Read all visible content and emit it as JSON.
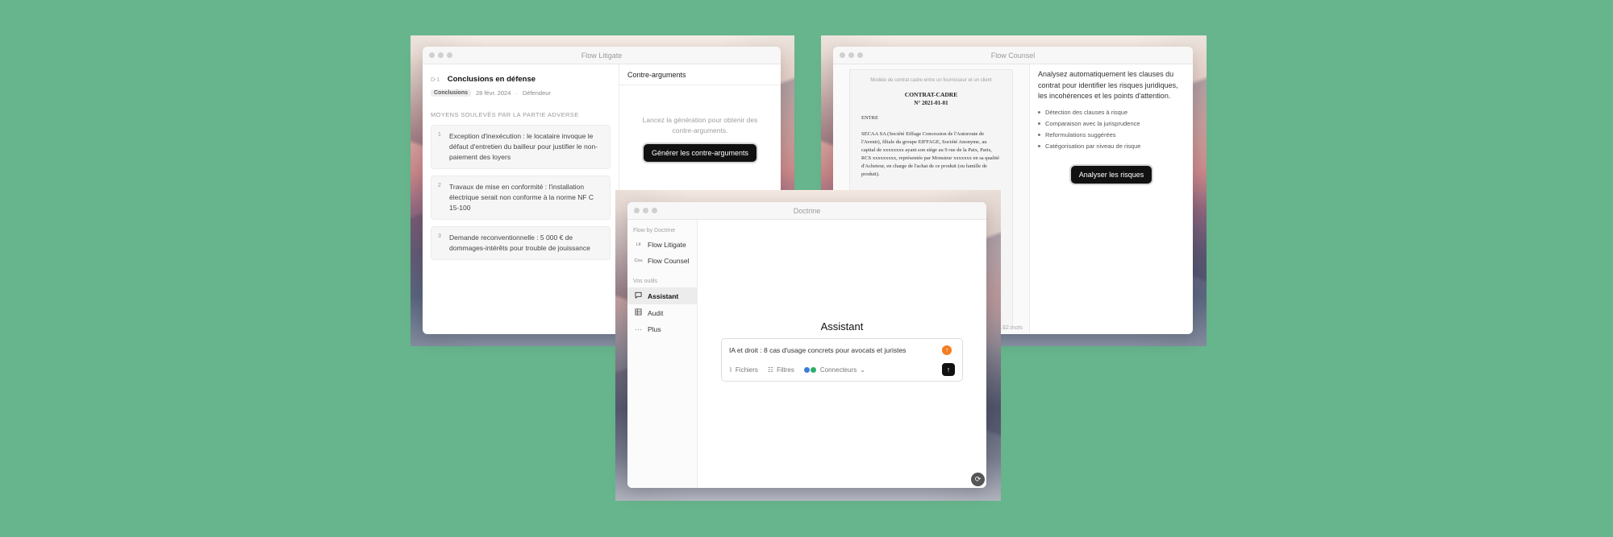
{
  "litigate": {
    "window_title": "Flow Litigate",
    "doc_id": "D-1",
    "doc_title": "Conclusions en défense",
    "tag": "Conclusions",
    "date": "28 févr. 2024",
    "role": "Défendeur",
    "section_title": "MOYENS SOULEVÉS PAR LA PARTIE ADVERSE",
    "arguments": [
      {
        "num": "1",
        "text": "Exception d'inexécution : le locataire invoque le défaut d'entretien du bailleur pour justifier le non-paiement des loyers"
      },
      {
        "num": "2",
        "text": "Travaux de mise en conformité : l'installation électrique serait non conforme à la norme NF C 15-100"
      },
      {
        "num": "3",
        "text": "Demande reconventionnelle : 5 000 € de dommages-intérêts pour trouble de jouissance"
      }
    ],
    "right_title": "Contre-arguments",
    "hint": "Lancez la génération pour obtenir des contre-arguments.",
    "button": "Générer les contre-arguments"
  },
  "counsel": {
    "window_title": "Flow Counsel",
    "paper_small": "Modèle de contrat cadre entre un fournisseur et un client",
    "paper_heading": "CONTRAT-CADRE",
    "paper_number": "N° 2021-01-01",
    "paper_between": "ENTRE",
    "paper_body": "SECAA SA (Société Eiffage Concession de l'Autoroute de l'Avenir), filiale du groupe EIFFAGE, Société Anonyme, au capital de xxxxxxxx ayant son siège au 9 rue de la Paix, Paris, RCS xxxxxxxxx, représentée par Monsieur xxxxxxx en sa qualité d'Acheteur, en charge de l'achat de ce produit (ou famille de produit).",
    "words": "62 mots",
    "description": "Analysez automatiquement les clauses du contrat pour identifier les risques juridiques, les incohérences et les points d'attention.",
    "features": [
      "Détection des clauses à risque",
      "Comparaison avec la jurisprudence",
      "Reformulations suggérées",
      "Catégorisation par niveau de risque"
    ],
    "button": "Analyser les risques"
  },
  "doctrine": {
    "window_title": "Doctrine",
    "section_flow": "Flow by Doctrine",
    "flows": [
      {
        "abbr": "Lit",
        "label": "Flow Litigate"
      },
      {
        "abbr": "Cou",
        "label": "Flow Counsel"
      }
    ],
    "section_tools": "Vos outils",
    "tools": [
      {
        "icon": "chat-icon",
        "label": "Assistant",
        "active": true
      },
      {
        "icon": "table-icon",
        "label": "Audit",
        "active": false
      },
      {
        "icon": "more-icon",
        "label": "Plus",
        "active": false
      }
    ],
    "title": "Assistant",
    "composer_text": "IA et droit : 8 cas d'usage concrets pour avocats et juristes",
    "files_label": "Fichiers",
    "filters_label": "Filtres",
    "connectors_label": "Connecteurs"
  },
  "colors": {
    "background": "#67b58c",
    "accent_orange": "#f57c22",
    "button_dark": "#111111"
  }
}
